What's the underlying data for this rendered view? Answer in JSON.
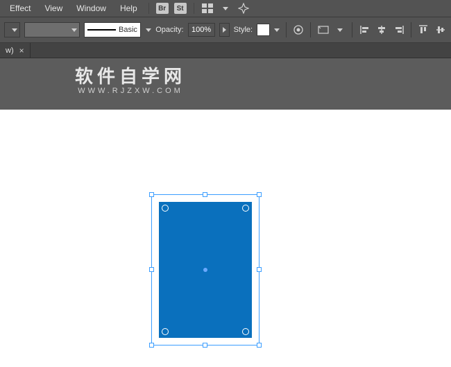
{
  "menubar": {
    "items": [
      "Effect",
      "View",
      "Window",
      "Help"
    ],
    "badges": [
      "Br",
      "St"
    ]
  },
  "ctrlbar": {
    "brush_label": "Basic",
    "opacity_label": "Opacity:",
    "opacity_value": "100%",
    "style_label": "Style:"
  },
  "tab": {
    "label": "w)",
    "close": "×"
  },
  "watermark": {
    "title": "软件自学网",
    "subtitle": "WWW.RJZXW.COM"
  },
  "colors": {
    "shape_fill": "#0a70bd",
    "selection_border": "#3a9dff",
    "ui_bg": "#535353"
  },
  "chart_data": null
}
